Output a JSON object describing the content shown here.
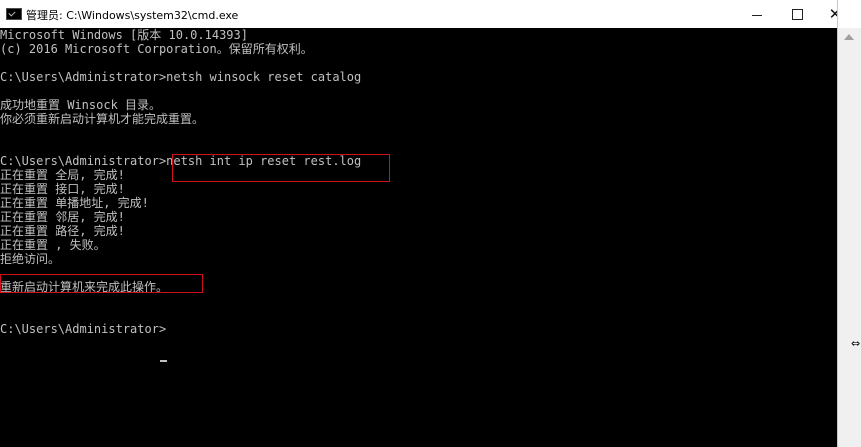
{
  "window": {
    "title": "管理员: C:\\Windows\\system32\\cmd.exe",
    "controls": {
      "minimize_icon": "minimize-icon",
      "maximize_icon": "maximize-icon",
      "close_label": "✕"
    },
    "app_icon": "cmd-icon"
  },
  "console": {
    "lines": [
      "Microsoft Windows [版本 10.0.14393]",
      "(c) 2016 Microsoft Corporation。保留所有权利。",
      "",
      "C:\\Users\\Administrator>netsh winsock reset catalog",
      "",
      "成功地重置 Winsock 目录。",
      "你必须重新启动计算机才能完成重置。",
      "",
      "",
      "C:\\Users\\Administrator>netsh int ip reset rest.log",
      "正在重置 全局, 完成!",
      "正在重置 接口, 完成!",
      "正在重置 单播地址, 完成!",
      "正在重置 邻居, 完成!",
      "正在重置 路径, 完成!",
      "正在重置 , 失败。",
      "拒绝访问。",
      "",
      "重新启动计算机来完成此操作。",
      "",
      "",
      "C:\\Users\\Administrator>"
    ]
  },
  "colors": {
    "console_background": "#000000",
    "console_text": "#c0c0c0",
    "highlight_box": "#d0101a",
    "titlebar_background": "#ffffff"
  },
  "annotations": {
    "command_highlight": "red-outline",
    "restart_highlight": "red-outline"
  },
  "scrollbar": {
    "up_arrow_icon": "scroll-up-icon"
  },
  "pointer": {
    "icon": "resize-horizontal-icon",
    "glyph": "⇔"
  }
}
